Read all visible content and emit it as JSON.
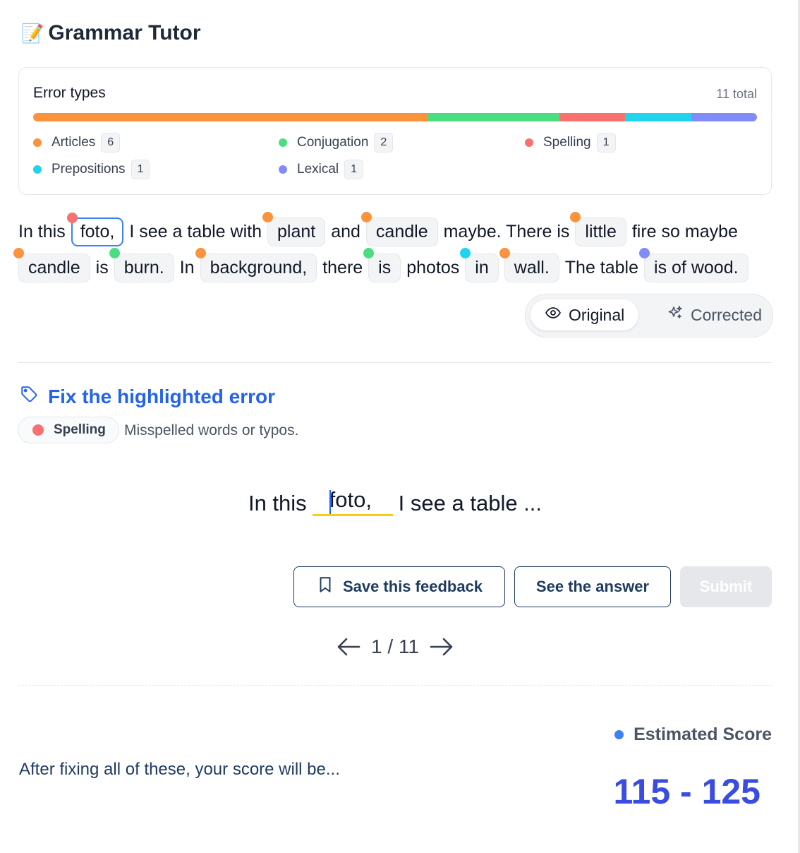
{
  "app": {
    "title_emoji": "📝",
    "title": "Grammar Tutor"
  },
  "error_summary": {
    "title": "Error types",
    "total": "11 total",
    "categories": [
      {
        "label": "Articles",
        "count": 6,
        "color": "#fb923c"
      },
      {
        "label": "Conjugation",
        "count": 2,
        "color": "#4ade80"
      },
      {
        "label": "Spelling",
        "count": 1,
        "color": "#f87171"
      },
      {
        "label": "Prepositions",
        "count": 1,
        "color": "#22d3ee"
      },
      {
        "label": "Lexical",
        "count": 1,
        "color": "#818cf8"
      }
    ]
  },
  "essay": {
    "line1": [
      {
        "text": "In this"
      },
      {
        "text": "foto,",
        "error": "spelling",
        "active": true
      },
      {
        "text": "I see a table with"
      },
      {
        "text": "plant",
        "error": "articles"
      },
      {
        "text": "and"
      },
      {
        "text": "candle",
        "error": "articles"
      },
      {
        "text": "maybe. There is"
      },
      {
        "text": "little",
        "error": "articles"
      },
      {
        "text": "fire so maybe"
      }
    ],
    "line2": [
      {
        "text": "candle",
        "error": "articles"
      },
      {
        "text": "is"
      },
      {
        "text": "burn.",
        "error": "conjugation"
      },
      {
        "text": "In"
      },
      {
        "text": "background,",
        "error": "articles"
      },
      {
        "text": "there"
      },
      {
        "text": "is",
        "error": "conjugation"
      },
      {
        "text": "photos"
      },
      {
        "text": "in",
        "error": "prepositions"
      },
      {
        "text": "wall.",
        "error": "articles"
      },
      {
        "text": "The table"
      },
      {
        "text": "is of wood.",
        "error": "lexical"
      }
    ]
  },
  "view_toggle": {
    "original_label": "Original",
    "corrected_label": "Corrected",
    "selected": "Original"
  },
  "exercise": {
    "heading": "Fix the highlighted error",
    "category_label": "Spelling",
    "category_color": "#f87171",
    "category_description": "Misspelled words or typos.",
    "sentence_before": "In this",
    "input_value": "foto,",
    "sentence_after": "I see a table ..."
  },
  "actions": {
    "save_label": "Save this feedback",
    "answer_label": "See the answer",
    "submit_label": "Submit"
  },
  "pager": {
    "position": "1 / 11"
  },
  "score": {
    "label": "Estimated Score",
    "note": "After fixing all of these, your score will be...",
    "value": "115 - 125",
    "dot_color": "#3b82f6",
    "value_color": "#3b4de0"
  }
}
